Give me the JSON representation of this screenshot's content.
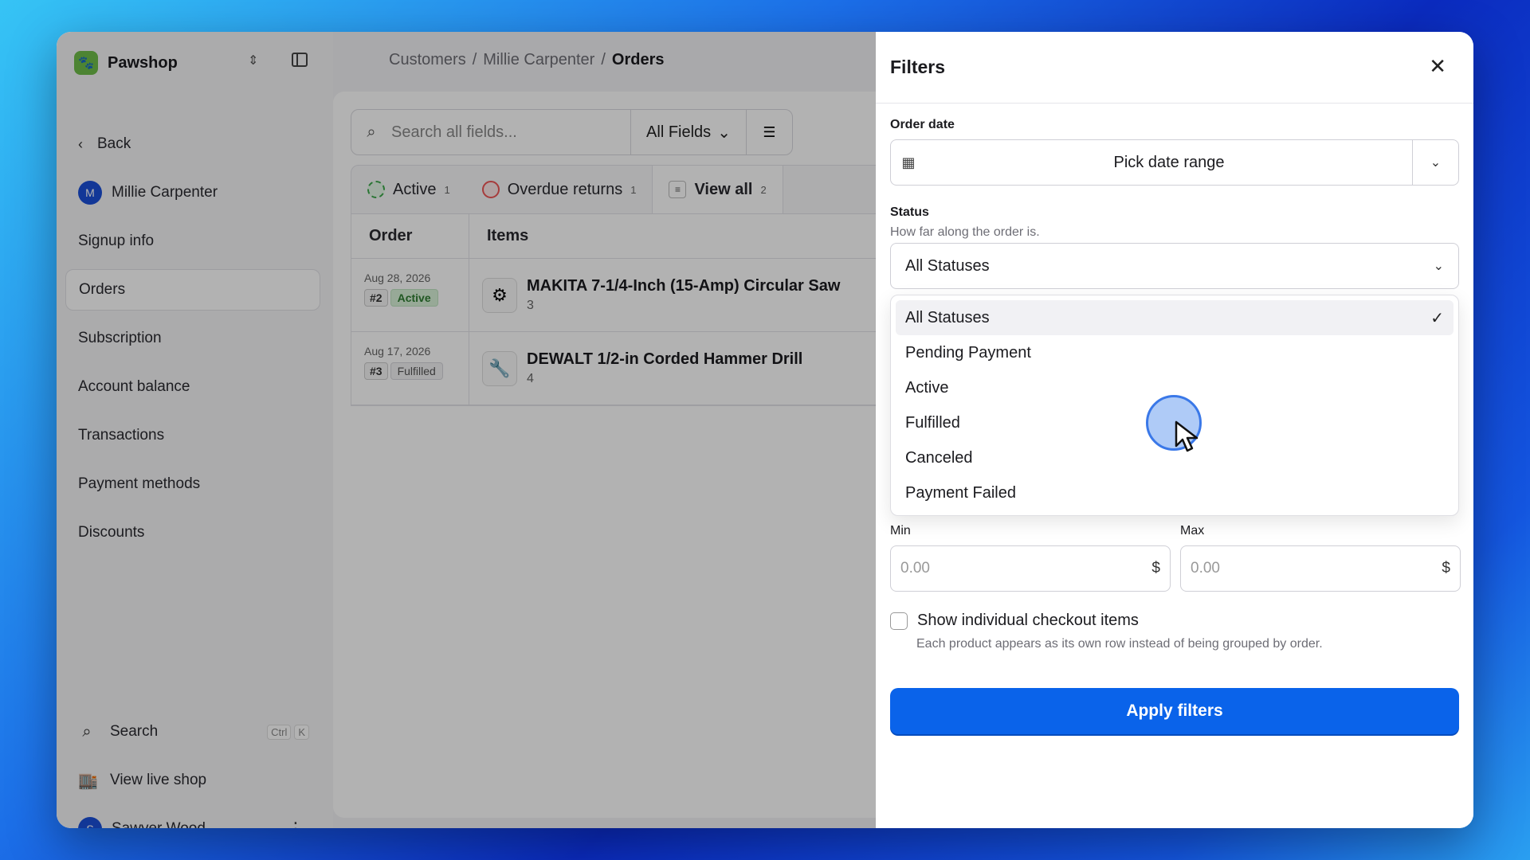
{
  "app": {
    "name": "Pawshop"
  },
  "breadcrumb": {
    "part1": "Customers",
    "sep": "/",
    "part2": "Millie Carpenter",
    "current": "Orders"
  },
  "sidebar": {
    "back": "Back",
    "customer": {
      "initial": "M",
      "name": "Millie Carpenter"
    },
    "items": [
      "Signup info",
      "Orders",
      "Subscription",
      "Account balance",
      "Transactions",
      "Payment methods",
      "Discounts"
    ],
    "active": "Orders",
    "search": {
      "label": "Search",
      "kbd1": "Ctrl",
      "kbd2": "K"
    },
    "view_shop": "View live shop",
    "user": {
      "initial": "S",
      "name": "Sawyer Wood"
    }
  },
  "toolbar": {
    "search_placeholder": "Search all fields...",
    "fields": "All Fields"
  },
  "tabs": [
    {
      "label": "Active",
      "count": "1"
    },
    {
      "label": "Overdue returns",
      "count": "1"
    },
    {
      "label": "View all",
      "count": "2"
    }
  ],
  "table": {
    "headers": [
      "Order",
      "Items"
    ],
    "rows": [
      {
        "date": "Aug 28, 2026",
        "num": "#2",
        "status": "Active",
        "item": "MAKITA 7-1/4-Inch (15-Amp) Circular Saw",
        "qty": "3"
      },
      {
        "date": "Aug 17, 2026",
        "num": "#3",
        "status": "Fulfilled",
        "item": "DEWALT 1/2-in Corded Hammer Drill",
        "qty": "4"
      }
    ]
  },
  "filters": {
    "title": "Filters",
    "order_date_label": "Order date",
    "date_placeholder": "Pick date range",
    "status_label": "Status",
    "status_hint": "How far along the order is.",
    "status_value": "All Statuses",
    "options": [
      "All Statuses",
      "Pending Payment",
      "Active",
      "Fulfilled",
      "Canceled",
      "Payment Failed"
    ],
    "min_label": "Min",
    "max_label": "Max",
    "min_value": "0.00",
    "max_value": "0.00",
    "currency": "$",
    "checkbox_label": "Show individual checkout items",
    "checkbox_hint": "Each product appears as its own row instead of being grouped by order.",
    "apply": "Apply filters"
  },
  "colors": {
    "accent": "#0a63ea",
    "active_tag": "#d8f2d9",
    "brand_logo": "#6fbd4a"
  }
}
